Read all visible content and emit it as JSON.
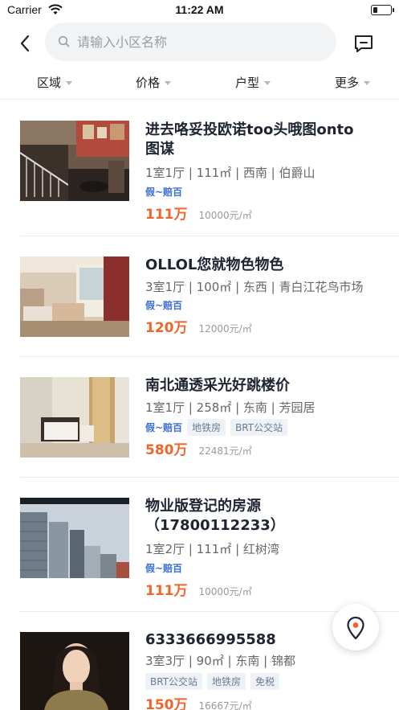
{
  "status_bar": {
    "carrier": "Carrier",
    "time": "11:22 AM"
  },
  "search": {
    "placeholder": "请输入小区名称"
  },
  "filters": [
    {
      "label": "区域"
    },
    {
      "label": "价格"
    },
    {
      "label": "户型"
    },
    {
      "label": "更多"
    }
  ],
  "listings": [
    {
      "title_lines": [
        "进去咯妥投欧诺too头哦图onto",
        "图谋"
      ],
      "meta": "1室1厅 | 111㎡ | 西南 | 伯爵山",
      "tag_fake": "假~赔百",
      "tags": [],
      "price": "111万",
      "unit_price": "10000元/㎡",
      "thumb": "interior-stairs"
    },
    {
      "title_lines": [
        "OLLOL您就物色物色"
      ],
      "meta": "3室1厅 | 100㎡ | 东西 | 青白江花鸟市场",
      "tag_fake": "假~赔百",
      "tags": [],
      "price": "120万",
      "unit_price": "12000元/㎡",
      "thumb": "living-room"
    },
    {
      "title_lines": [
        "南北通透采光好跳楼价"
      ],
      "meta": "1室1厅 | 258㎡ | 东南 | 芳园居",
      "tag_fake": "假~赔百",
      "tags": [
        "地铁房",
        "BRT公交站"
      ],
      "price": "580万",
      "unit_price": "22481元/㎡",
      "thumb": "bedroom"
    },
    {
      "title_lines": [
        "物业版登记的房源",
        "（17800112233）"
      ],
      "meta": "1室2厅 | 111㎡ | 红树湾",
      "tag_fake": "假~赔百",
      "tags": [],
      "price": "111万",
      "unit_price": "10000元/㎡",
      "thumb": "skyscrapers"
    },
    {
      "title_lines": [
        "6333666995588"
      ],
      "meta": "3室3厅 | 90㎡ | 东南 | 锦都",
      "tag_fake": "",
      "tags": [
        "BRT公交站",
        "地铁房",
        "免税"
      ],
      "price": "150万",
      "unit_price": "16667元/㎡",
      "thumb": "portrait"
    }
  ],
  "colors": {
    "price": "#f0652a",
    "fake_tag": "#3b6fd6",
    "title": "#1e2432"
  },
  "icons": {
    "back": "chevron-left-icon",
    "search": "search-icon",
    "message": "message-icon",
    "map": "location-pin-icon"
  }
}
